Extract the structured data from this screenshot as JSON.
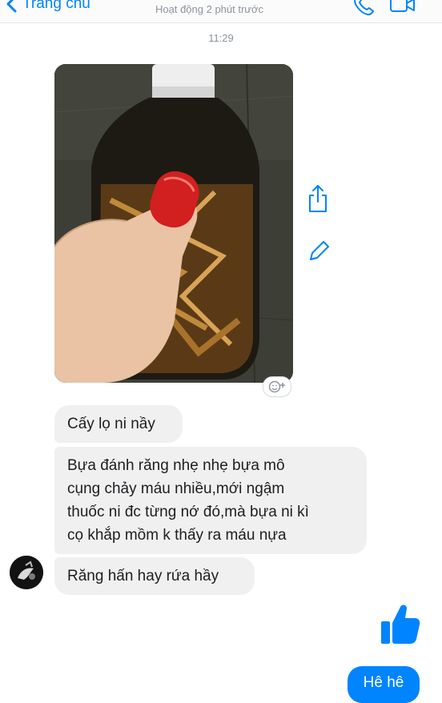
{
  "header": {
    "back_label": "Trang chủ",
    "status": "Hoạt động 2 phút trước",
    "icons": [
      "chevron-left-icon",
      "phone-icon",
      "video-camera-icon"
    ]
  },
  "timestamp": "11:29",
  "photo": {
    "description_icon": "image",
    "side_actions": [
      "share-icon",
      "edit-icon"
    ],
    "reaction_icon": "add-reaction-icon"
  },
  "messages": {
    "received": [
      {
        "text_lines": [
          "Cấy lọ ni nầy"
        ]
      },
      {
        "text_lines": [
          "Bựa đánh răng nhẹ nhẹ bựa mô",
          "cụng chảy máu nhiều,mới ngậm",
          "thuốc ni đc từng nớ đó,mà bựa ni kì",
          "cọ khắp mồm k thấy ra máu nựa"
        ]
      },
      {
        "text_lines": [
          "Răng hấn hay rứa hầy"
        ]
      }
    ],
    "sent": [
      {
        "type": "like",
        "icon": "thumbs-up-icon"
      },
      {
        "text": "Hê hê"
      }
    ]
  },
  "colors": {
    "accent": "#0084ff",
    "received_bubble": "#f1f0f0",
    "muted_text": "#8d949e"
  }
}
